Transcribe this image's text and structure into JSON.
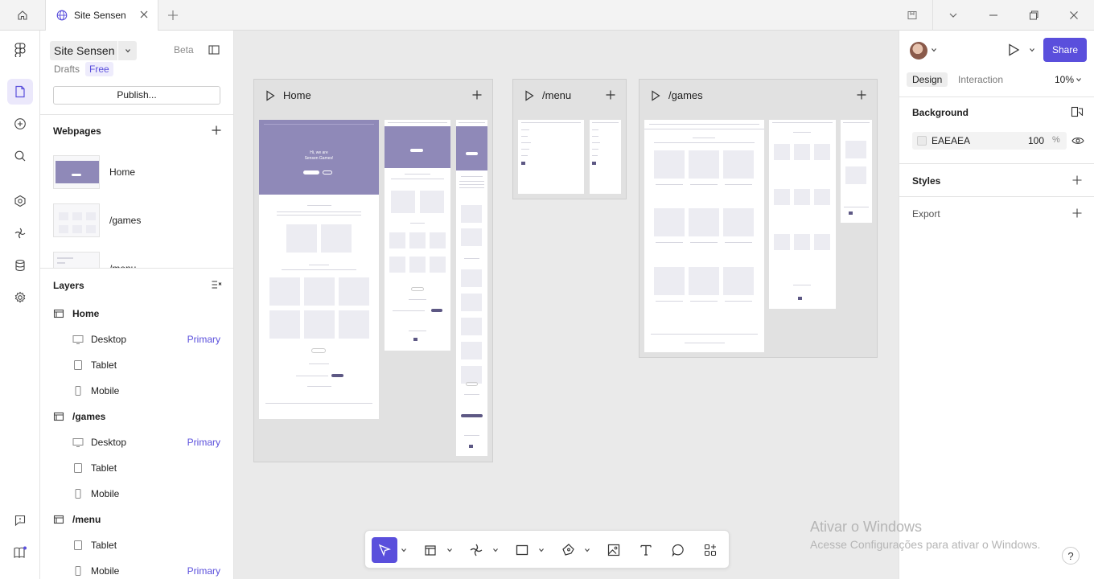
{
  "tab": {
    "title": "Site Sensen"
  },
  "project": {
    "name": "Site Sensen",
    "badge": "Beta",
    "location": "Drafts",
    "plan": "Free",
    "publish_label": "Publish..."
  },
  "webpages": {
    "title": "Webpages",
    "items": [
      {
        "label": "Home"
      },
      {
        "label": "/games"
      },
      {
        "label": "/menu"
      }
    ]
  },
  "layers": {
    "title": "Layers",
    "pages": [
      {
        "label": "Home",
        "items": [
          {
            "label": "Desktop",
            "tag": "Primary",
            "icon": "desktop-icon"
          },
          {
            "label": "Tablet",
            "tag": "",
            "icon": "tablet-icon"
          },
          {
            "label": "Mobile",
            "tag": "",
            "icon": "mobile-icon"
          }
        ]
      },
      {
        "label": "/games",
        "items": [
          {
            "label": "Desktop",
            "tag": "Primary",
            "icon": "desktop-icon"
          },
          {
            "label": "Tablet",
            "tag": "",
            "icon": "tablet-icon"
          },
          {
            "label": "Mobile",
            "tag": "",
            "icon": "mobile-icon"
          }
        ]
      },
      {
        "label": "/menu",
        "items": [
          {
            "label": "Tablet",
            "tag": "",
            "icon": "tablet-icon"
          },
          {
            "label": "Mobile",
            "tag": "Primary",
            "icon": "mobile-icon"
          }
        ]
      }
    ]
  },
  "canvas": {
    "frames": [
      {
        "title": "Home"
      },
      {
        "title": "/menu"
      },
      {
        "title": "/games"
      }
    ],
    "home_hero": {
      "line1": "Hi, we are",
      "line2": "Sensen Games!"
    }
  },
  "design_panel": {
    "tabs": [
      {
        "label": "Design"
      },
      {
        "label": "Interaction"
      }
    ],
    "zoom": "10%",
    "share_label": "Share",
    "background": {
      "title": "Background",
      "hex": "EAEAEA",
      "opacity": "100",
      "unit": "%"
    },
    "styles_title": "Styles",
    "export_title": "Export"
  },
  "watermark": {
    "line1": "Ativar o Windows",
    "line2": "Acesse Configurações para ativar o Windows."
  },
  "help_label": "?",
  "colors": {
    "accent": "#5a4fdc",
    "hero": "#8f89b8",
    "canvas": "#eaeaea"
  }
}
